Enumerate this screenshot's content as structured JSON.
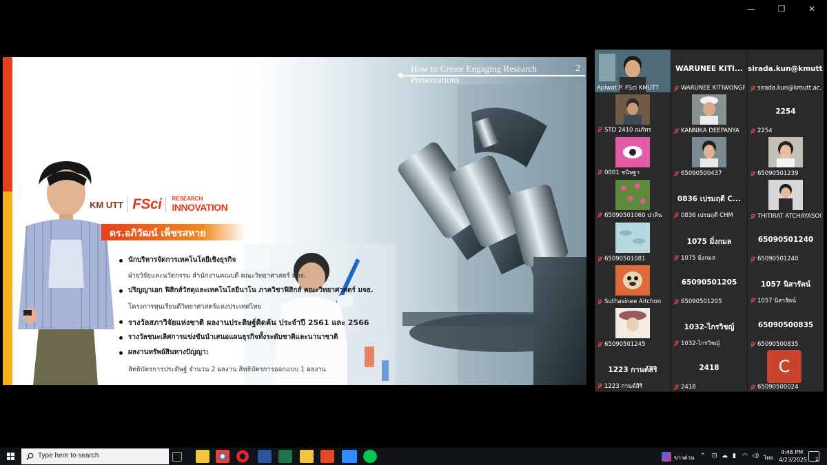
{
  "window_controls": {
    "minimize": "—",
    "restore": "❐",
    "close": "✕"
  },
  "slide": {
    "title": "How to Create Engaging Research Presentations",
    "number": "2",
    "logos": {
      "kmutt": "KM UTT",
      "fsci": "FSci",
      "ri_top": "RESEARCH",
      "ri_main": "INNOVATION"
    },
    "name": "ดร.อภิวัฒน์ เพ็ชรสหาย",
    "bio": [
      {
        "text": "นักบริหารจัดการเทคโนโลยีเชิงธุรกิจ",
        "bold": true,
        "bullet": true
      },
      {
        "text": "ฝ่ายวิจัยและนวัตกรรม สำนักงานคณบดี คณะวิทยาศาสตร์ มจธ.",
        "bold": false,
        "bullet": false
      },
      {
        "text": "ปริญญาเอก ฟิสิกส์วัสดุและเทคโนโลยีนาโน ภาควิชาฟิสิกส์ คณะวิทยาศาสตร์ มจธ.",
        "bold": true,
        "bullet": true
      },
      {
        "text": "โครงการทุนเรียนดีวิทยาศาสตร์แห่งประเทศไทย",
        "bold": false,
        "bullet": false
      },
      {
        "text": "รางวัลสภาวิจัยแห่งชาติ ผลงานประดิษฐ์คิดค้น ประจำปี 2561 และ 2566",
        "bold": true,
        "bullet": true
      },
      {
        "text": "รางวัลชนะเลิศการแข่งขันนำเสนอแผนธุรกิจทั้งระดับชาติและนานาชาติ",
        "bold": true,
        "bullet": true
      },
      {
        "text": "ผลงานทรัพย์สินทางปัญญา:",
        "bold": true,
        "bullet": true
      },
      {
        "text": "สิทธิบัตรการประดิษฐ์ จำนวน 2 ผลงาน สิทธิบัตรการออกแบบ 1 ผลงาน",
        "bold": false,
        "bullet": false
      }
    ]
  },
  "participants": [
    {
      "label": "Apiwat P. FSci KMUTT",
      "big": "",
      "muted": false,
      "video": "host",
      "active": true
    },
    {
      "label": "WARUNEE KITIWONGPR...",
      "big": "WARUNEE KITI...",
      "muted": true,
      "video": "",
      "active": false
    },
    {
      "label": "sirada.kun@kmutt.ac.th",
      "big": "sirada.kun@kmutt...",
      "muted": true,
      "video": "",
      "active": false
    },
    {
      "label": "STD 2410 ณภัทร",
      "big": "",
      "muted": true,
      "video": "man",
      "active": false
    },
    {
      "label": "KANNIKA DEEPANYA",
      "big": "",
      "muted": true,
      "video": "woman-cap",
      "active": false
    },
    {
      "label": "2254",
      "big": "2254",
      "muted": true,
      "video": "",
      "active": false
    },
    {
      "label": "0001 ชนิษฐา",
      "big": "",
      "muted": true,
      "video": "pink",
      "active": false
    },
    {
      "label": "65090500437",
      "big": "",
      "muted": true,
      "video": "boy",
      "active": false
    },
    {
      "label": "65090501239",
      "big": "",
      "muted": true,
      "video": "girl",
      "active": false
    },
    {
      "label": "65090501060 ปาลิน",
      "big": "",
      "muted": true,
      "video": "flowers",
      "active": false
    },
    {
      "label": "0836 เปรมฤดี CHM",
      "big": "0836 เปรมฤดี C...",
      "muted": true,
      "video": "",
      "active": false
    },
    {
      "label": "THITIRAT ATCHAYASOO...",
      "big": "",
      "muted": true,
      "video": "girl2",
      "active": false
    },
    {
      "label": "65090501081",
      "big": "",
      "muted": true,
      "video": "cells",
      "active": false
    },
    {
      "label": "1075 มิ่งกมล",
      "big": "1075 มิ่งกมล",
      "muted": true,
      "video": "",
      "active": false
    },
    {
      "label": "65090501240",
      "big": "65090501240",
      "muted": true,
      "video": "",
      "active": false
    },
    {
      "label": "Suthasinee Aitchon",
      "big": "",
      "muted": true,
      "video": "pug",
      "active": false
    },
    {
      "label": "65090501205",
      "big": "65090501205",
      "muted": true,
      "video": "",
      "active": false
    },
    {
      "label": "1057 นิสารัตน์",
      "big": "1057 นิสารัตน์",
      "muted": true,
      "video": "",
      "active": false
    },
    {
      "label": "65090501245",
      "big": "",
      "muted": true,
      "video": "hat",
      "active": false
    },
    {
      "label": "1032-ไกรวิชญ์",
      "big": "1032-ไกรวิชญ์",
      "muted": true,
      "video": "",
      "active": false
    },
    {
      "label": "65090500835",
      "big": "65090500835",
      "muted": true,
      "video": "",
      "active": false
    },
    {
      "label": "1223 กานต์สิริ",
      "big": "1223 กานต์สิริ",
      "muted": true,
      "video": "",
      "active": false
    },
    {
      "label": "2418",
      "big": "2418",
      "muted": true,
      "video": "",
      "active": false
    },
    {
      "label": "65090500024",
      "big": "",
      "muted": true,
      "video": "avatar-c",
      "avatar_letter": "C",
      "active": false
    }
  ],
  "taskbar": {
    "search_placeholder": "Type here to search",
    "news": "ข่าวด่วน",
    "lang": "ไทย",
    "time": "4:46 PM",
    "date": "4/23/2025",
    "notif_count": "2"
  }
}
